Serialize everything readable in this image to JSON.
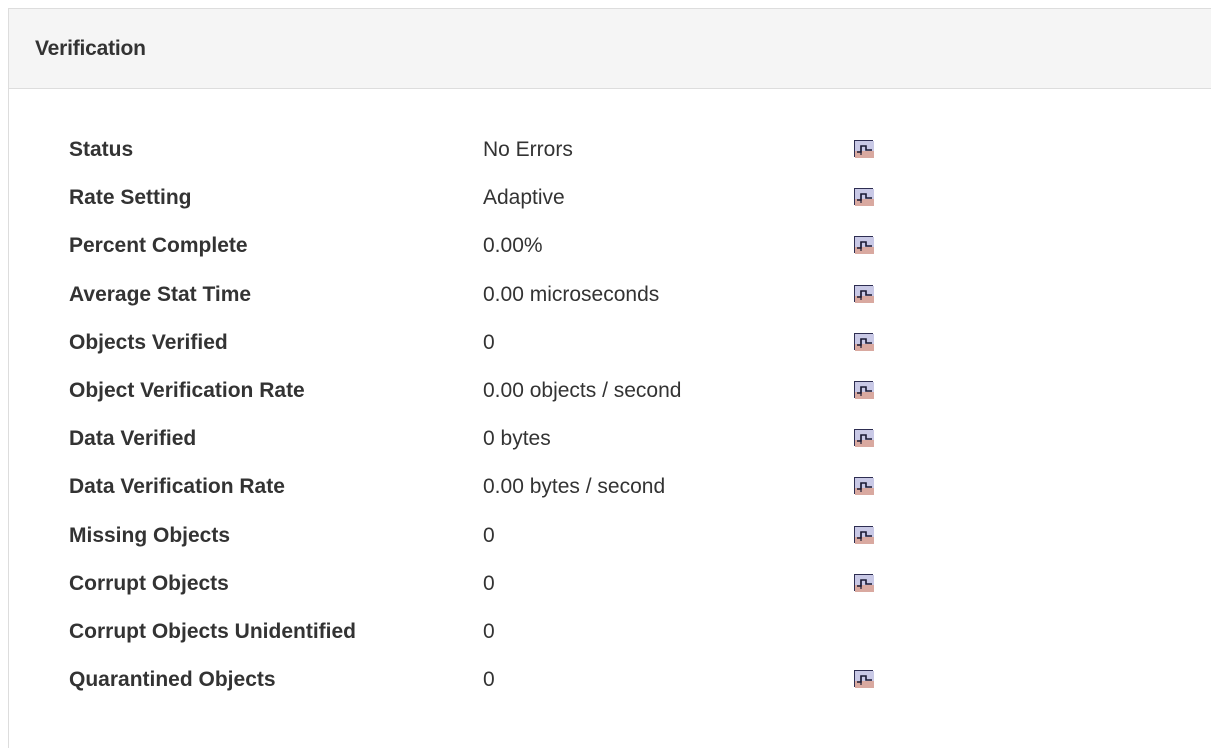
{
  "panel": {
    "title": "Verification"
  },
  "rows": [
    {
      "label": "Status",
      "value": "No Errors",
      "chart": true
    },
    {
      "label": "Rate Setting",
      "value": "Adaptive",
      "chart": true
    },
    {
      "label": "Percent Complete",
      "value": "0.00%",
      "chart": true
    },
    {
      "label": "Average Stat Time",
      "value": "0.00 microseconds",
      "chart": true
    },
    {
      "label": "Objects Verified",
      "value": "0",
      "chart": true
    },
    {
      "label": "Object Verification Rate",
      "value": "0.00 objects / second",
      "chart": true
    },
    {
      "label": "Data Verified",
      "value": "0 bytes",
      "chart": true
    },
    {
      "label": "Data Verification Rate",
      "value": "0.00 bytes / second",
      "chart": true
    },
    {
      "label": "Missing Objects",
      "value": "0",
      "chart": true
    },
    {
      "label": "Corrupt Objects",
      "value": "0",
      "chart": true
    },
    {
      "label": "Corrupt Objects Unidentified",
      "value": "0",
      "chart": false
    },
    {
      "label": "Quarantined Objects",
      "value": "0",
      "chart": true
    }
  ],
  "icons": {
    "chart": "chart-icon"
  }
}
